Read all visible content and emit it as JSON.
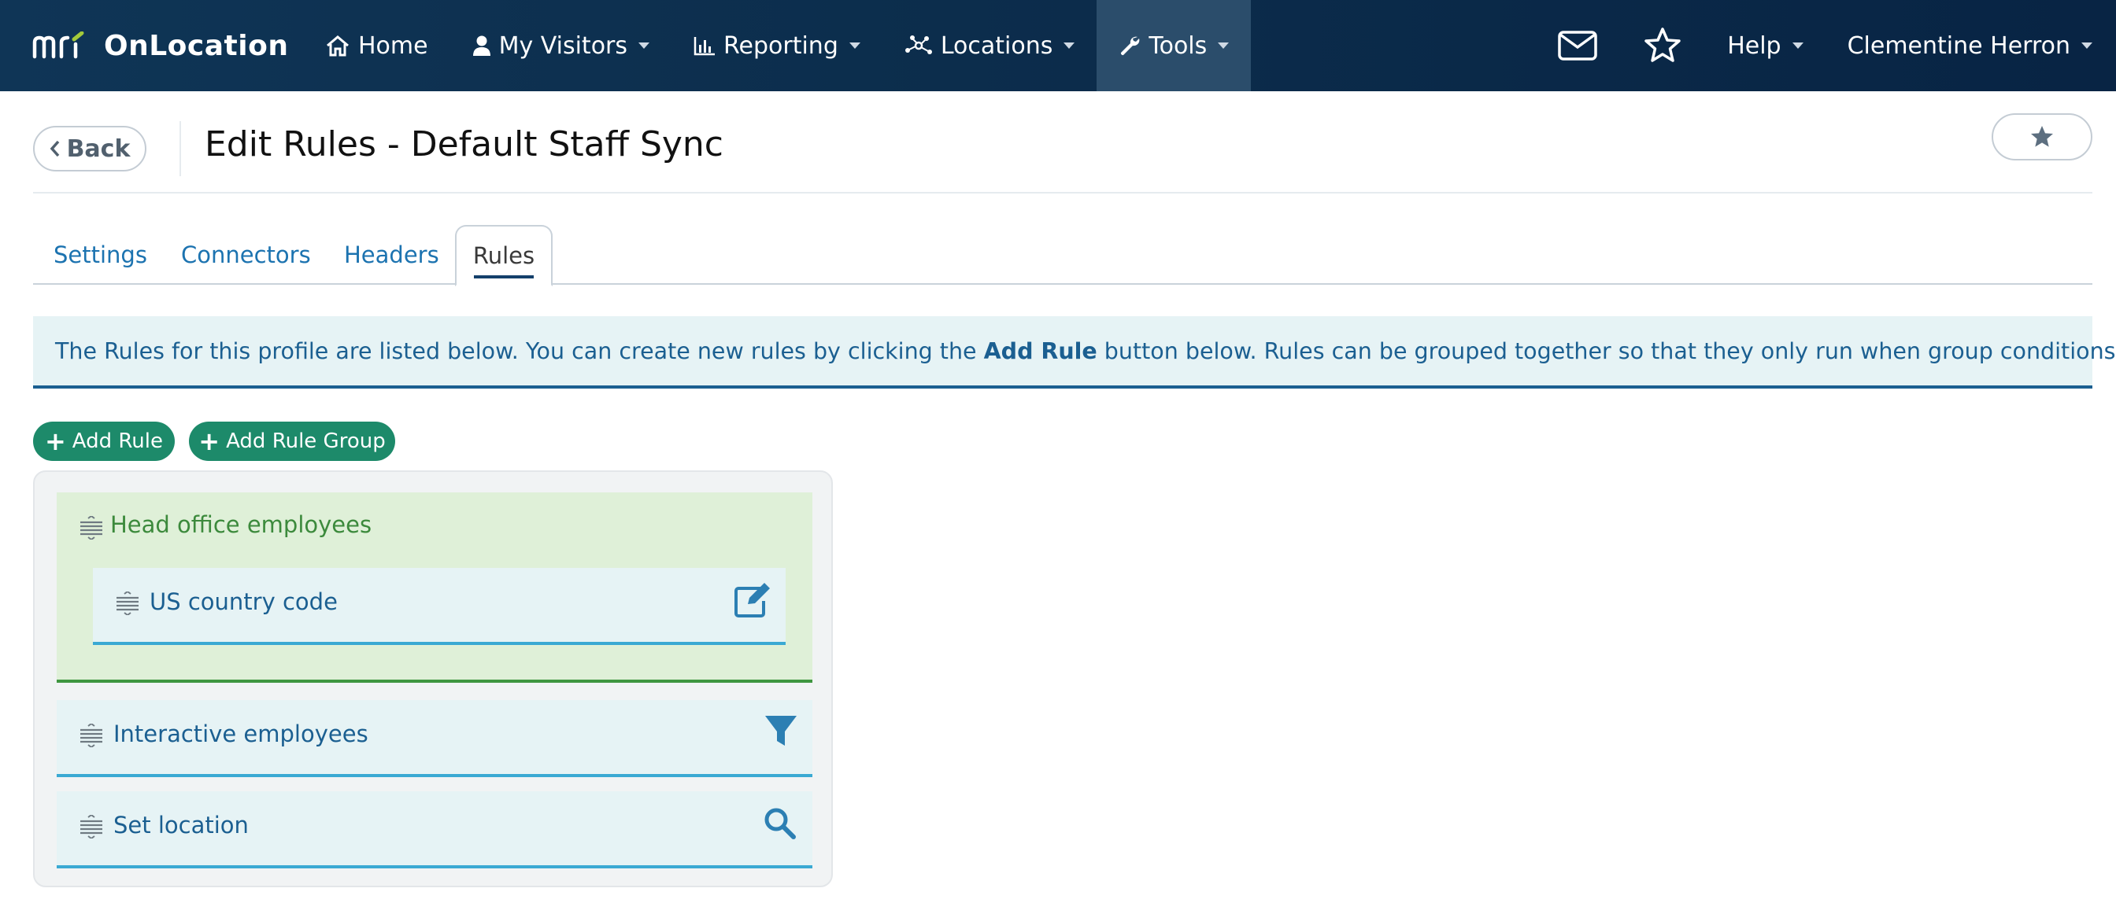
{
  "navbar": {
    "brand_name": "OnLocation",
    "items": [
      {
        "label": "Home",
        "icon": "home-icon"
      },
      {
        "label": "My Visitors",
        "icon": "user-icon"
      },
      {
        "label": "Reporting",
        "icon": "bar-chart-icon"
      },
      {
        "label": "Locations",
        "icon": "network-icon"
      },
      {
        "label": "Tools",
        "icon": "wrench-icon"
      }
    ],
    "active_item": "Tools",
    "help_label": "Help",
    "user_name": "Clementine Herron"
  },
  "header": {
    "back_label": "Back",
    "title": "Edit Rules - Default Staff Sync"
  },
  "tabs": [
    {
      "label": "Settings"
    },
    {
      "label": "Connectors"
    },
    {
      "label": "Headers"
    },
    {
      "label": "Rules"
    }
  ],
  "active_tab": "Rules",
  "alert": {
    "text_before": "The Rules for this profile are listed below. You can create new rules by clicking the ",
    "bold": "Add Rule",
    "text_after": " button below. Rules can be grouped together so that they only run when group conditions are met."
  },
  "buttons": {
    "add_rule": "Add Rule",
    "add_rule_group": "Add Rule Group"
  },
  "rules": {
    "group": {
      "title": "Head office employees",
      "rules": [
        {
          "label": "US country code",
          "action_icon": "edit-icon"
        }
      ]
    },
    "items": [
      {
        "label": "Interactive employees",
        "action_icon": "filter-icon"
      },
      {
        "label": "Set location",
        "action_icon": "search-icon"
      }
    ]
  },
  "colors": {
    "navbar": "#0c2d4c",
    "link": "#1c73b0",
    "success": "#1d8a6a",
    "group_bg": "#dff0d8",
    "rule_bg": "#e6f3f5",
    "rule_border": "#3aa9d3"
  }
}
